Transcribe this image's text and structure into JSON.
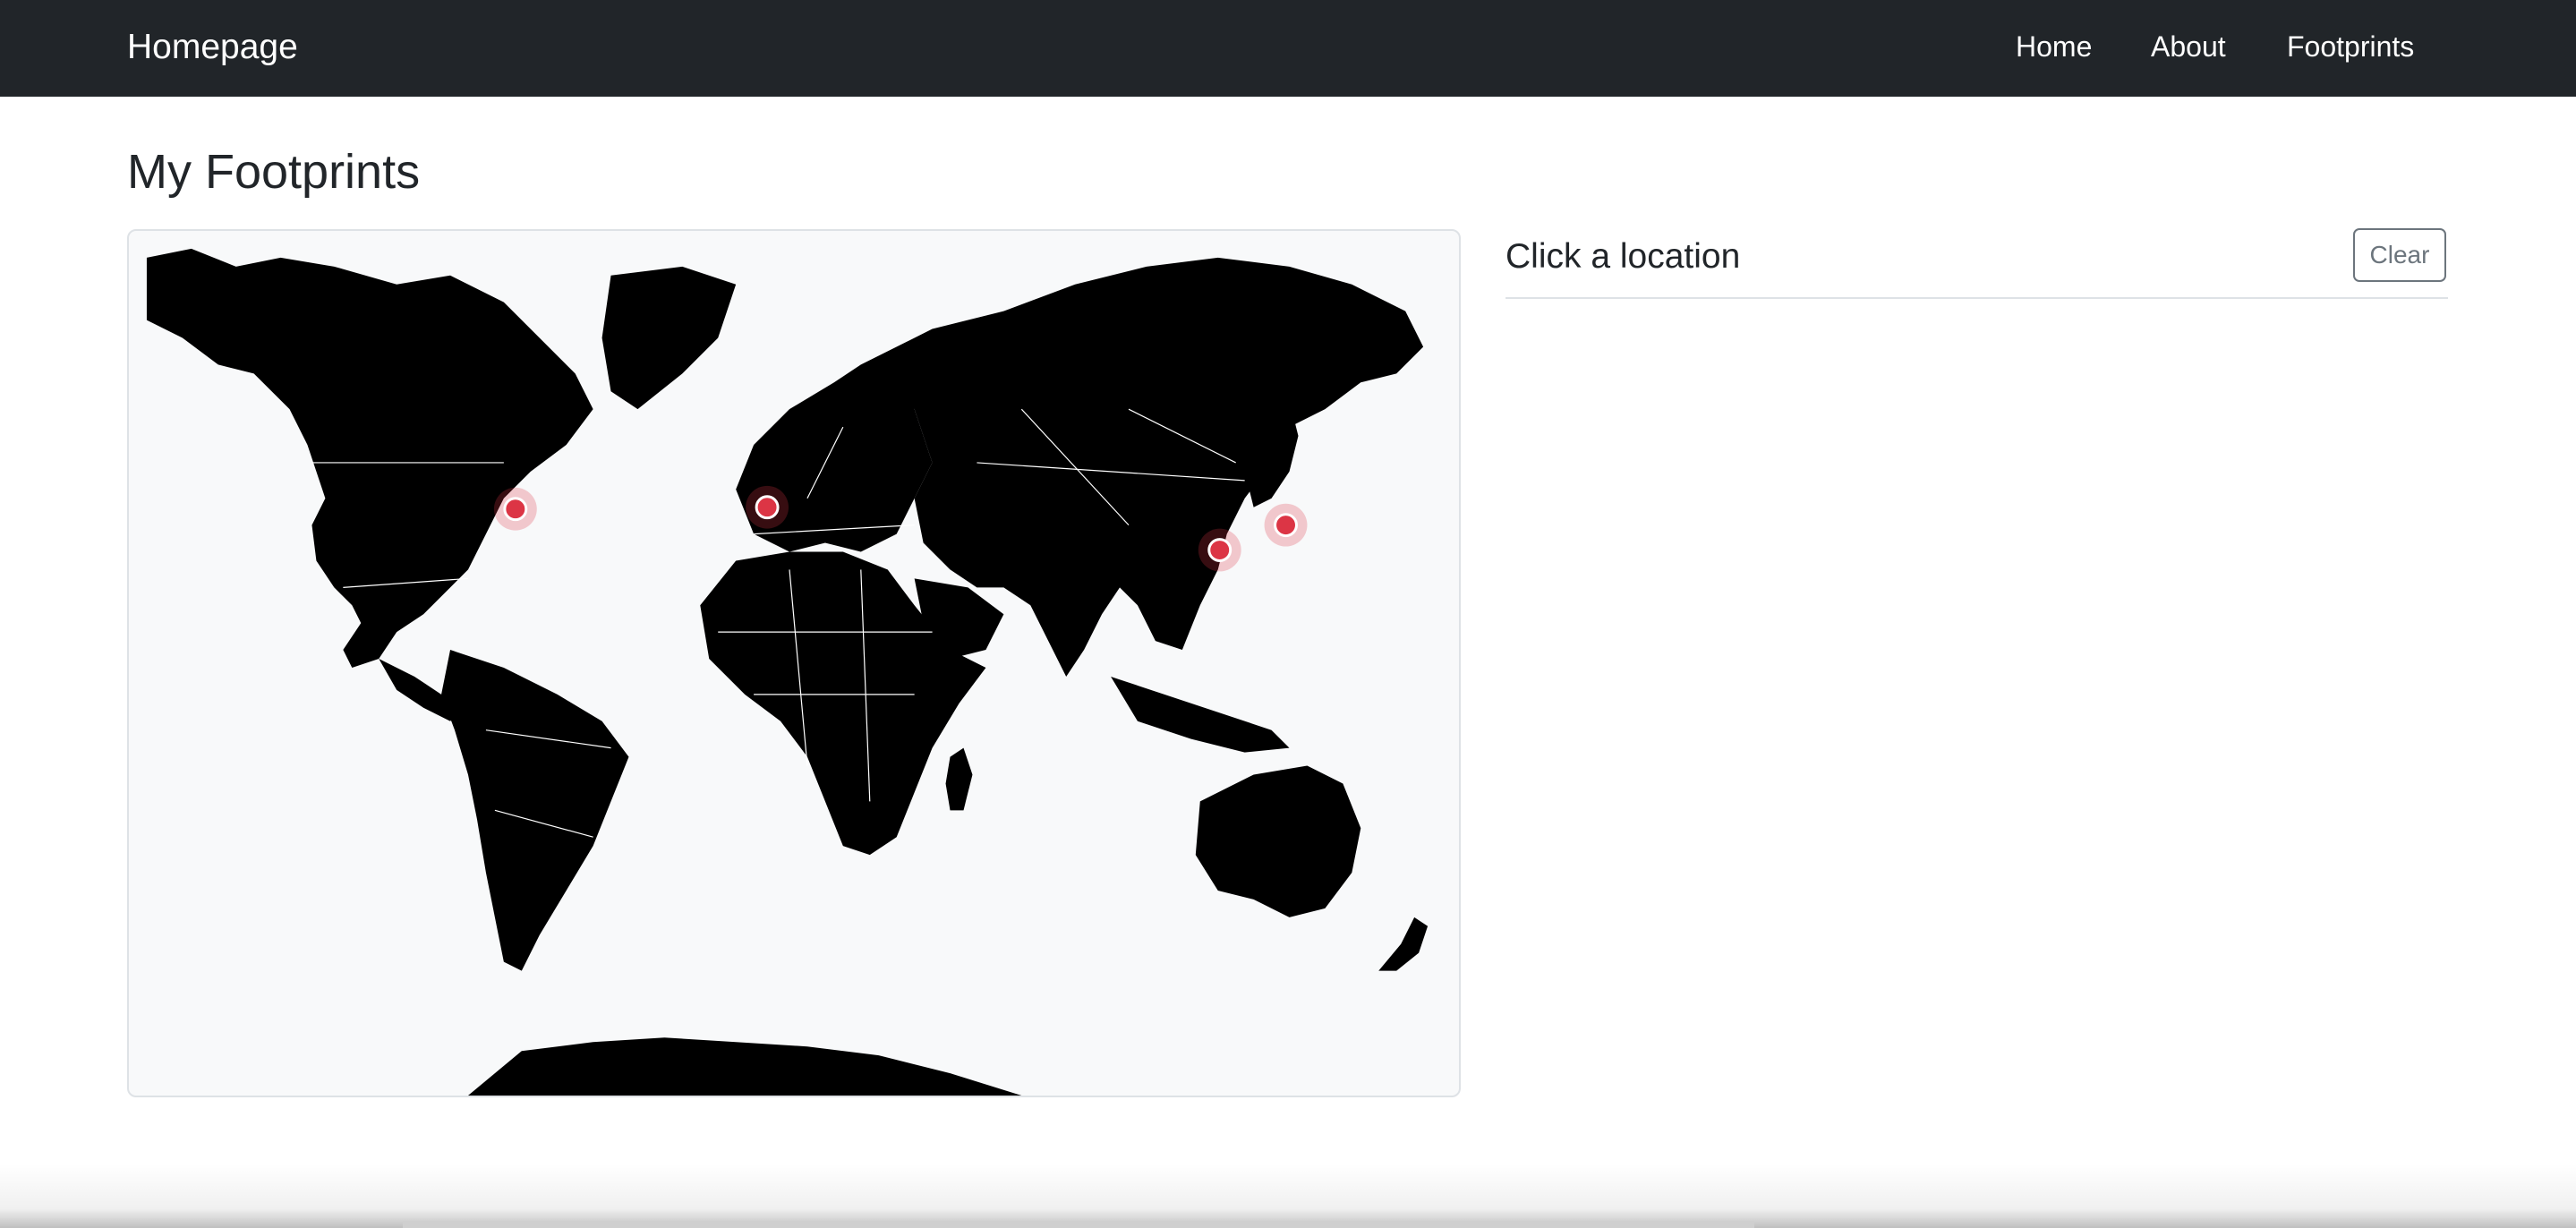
{
  "navbar": {
    "brand": "Homepage",
    "links": [
      "Home",
      "About",
      "Footprints"
    ]
  },
  "page": {
    "title": "My Footprints"
  },
  "panel": {
    "title": "Click a location",
    "clear_label": "Clear"
  },
  "map": {
    "markers": [
      "new-york",
      "barcelona",
      "shanghai",
      "tokyo"
    ],
    "land_color": "#000000",
    "ocean_color": "#f8f9fa",
    "marker_color": "#dc3545"
  }
}
